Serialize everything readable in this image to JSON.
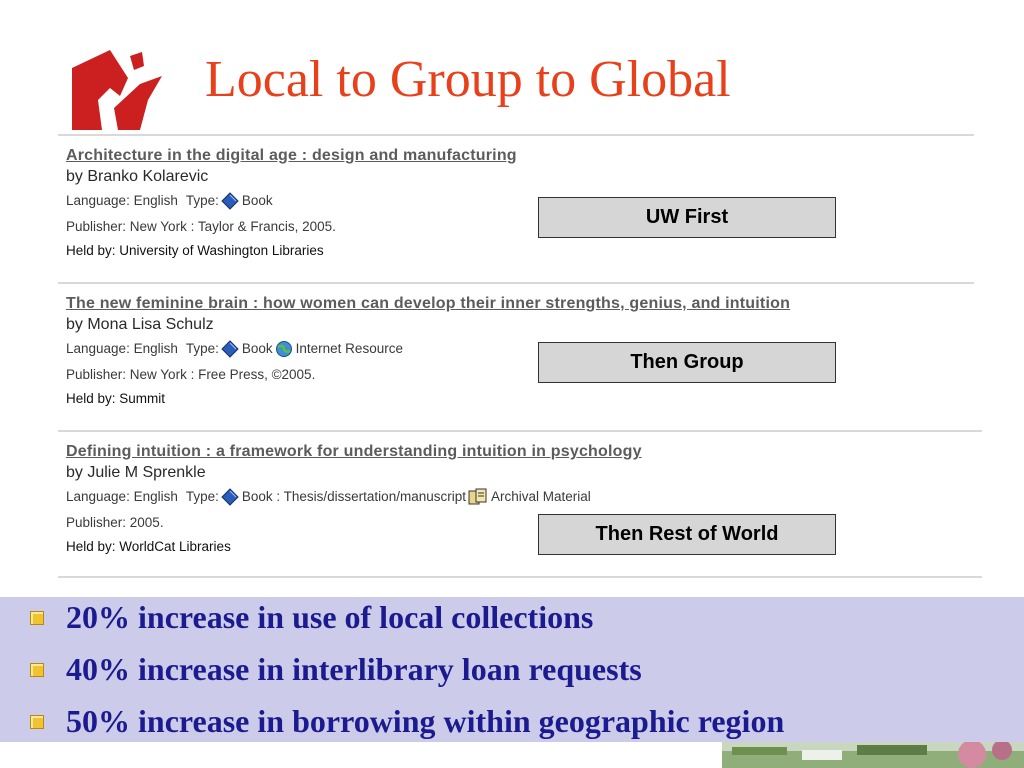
{
  "slide": {
    "title": "Local to Group to Global"
  },
  "records": [
    {
      "title": "Architecture in the digital age : design and manufacturing",
      "author": "by Branko Kolarevic",
      "language_label": "Language: English",
      "type_label": "Type:",
      "type_items": [
        {
          "icon": "book-icon",
          "text": "Book"
        }
      ],
      "publisher": "Publisher: New York : Taylor & Francis, 2005.",
      "held_by": "Held by: University of Washington Libraries"
    },
    {
      "title": "The new feminine brain : how women can develop their inner strengths, genius, and intuition",
      "author": "by Mona Lisa Schulz",
      "language_label": "Language: English",
      "type_label": "Type:",
      "type_items": [
        {
          "icon": "book-icon",
          "text": "Book"
        },
        {
          "icon": "internet-resource-icon",
          "text": "Internet Resource"
        }
      ],
      "publisher": "Publisher: New York : Free Press, ©2005.",
      "held_by": "Held by: Summit"
    },
    {
      "title": "Defining intuition : a framework for understanding intuition in psychology",
      "author": "by Julie M Sprenkle",
      "language_label": "Language: English",
      "type_label": "Type:",
      "type_items": [
        {
          "icon": "book-icon",
          "text": "Book : Thesis/dissertation/manuscript"
        },
        {
          "icon": "archival-material-icon",
          "text": "Archival Material"
        }
      ],
      "publisher": "Publisher: 2005.",
      "held_by": "Held by: WorldCat Libraries"
    }
  ],
  "callouts": [
    "UW First",
    "Then Group",
    "Then Rest of World"
  ],
  "stats": [
    "20% increase in use of local collections",
    "40% increase in interlibrary loan requests",
    "50% increase in borrowing within geographic region"
  ],
  "colors": {
    "title": "#e8401a",
    "stats_text": "#1b1b8f",
    "stats_background": "#ccccea",
    "bullet": "#f2c331",
    "callout_background": "#d6d6d6"
  }
}
